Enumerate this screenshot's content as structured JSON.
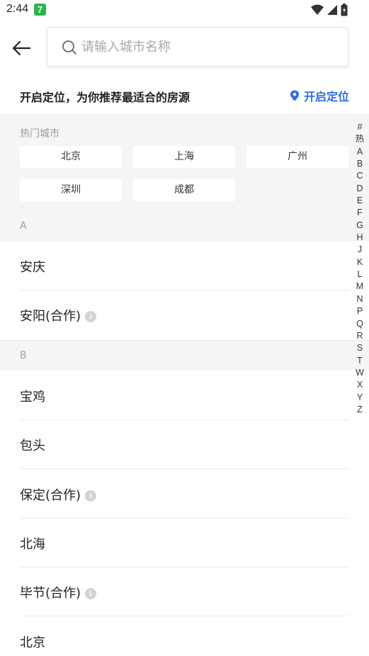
{
  "status_bar": {
    "time": "2:44",
    "app_badge": "7"
  },
  "search": {
    "placeholder": "请输入城市名称",
    "value": ""
  },
  "locate": {
    "tip": "开启定位，为你推荐最适合的房源",
    "action_label": "开启定位",
    "accent_color": "#2f6fea"
  },
  "hot": {
    "title": "热门城市",
    "cities": [
      "北京",
      "上海",
      "广州",
      "深圳",
      "成都"
    ]
  },
  "sections": [
    {
      "letter": "A",
      "items": [
        {
          "name": "安庆"
        },
        {
          "name": "安阳(合作)",
          "info": true
        }
      ]
    },
    {
      "letter": "B",
      "items": [
        {
          "name": "宝鸡"
        },
        {
          "name": "包头"
        },
        {
          "name": "保定(合作)",
          "info": true
        },
        {
          "name": "北海"
        },
        {
          "name": "毕节(合作)",
          "info": true
        },
        {
          "name": "北京"
        }
      ]
    }
  ],
  "index": [
    "#",
    "热",
    "A",
    "B",
    "C",
    "D",
    "E",
    "F",
    "G",
    "H",
    "J",
    "K",
    "L",
    "M",
    "N",
    "P",
    "Q",
    "R",
    "S",
    "T",
    "W",
    "X",
    "Y",
    "Z"
  ],
  "icons": {
    "info_glyph": "i"
  }
}
